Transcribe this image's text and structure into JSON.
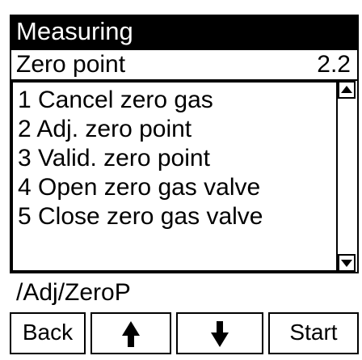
{
  "header": {
    "title": "Measuring"
  },
  "parameter": {
    "label": "Zero point",
    "value": "2.2"
  },
  "menu": {
    "items": [
      "1 Cancel zero gas",
      "2 Adj. zero point",
      "3 Valid. zero point",
      "4 Open zero gas valve",
      "5 Close zero gas valve"
    ]
  },
  "path": "/Adj/ZeroP",
  "softkeys": {
    "back": "Back",
    "up_icon": "arrow-up-icon",
    "down_icon": "arrow-down-icon",
    "start": "Start"
  }
}
